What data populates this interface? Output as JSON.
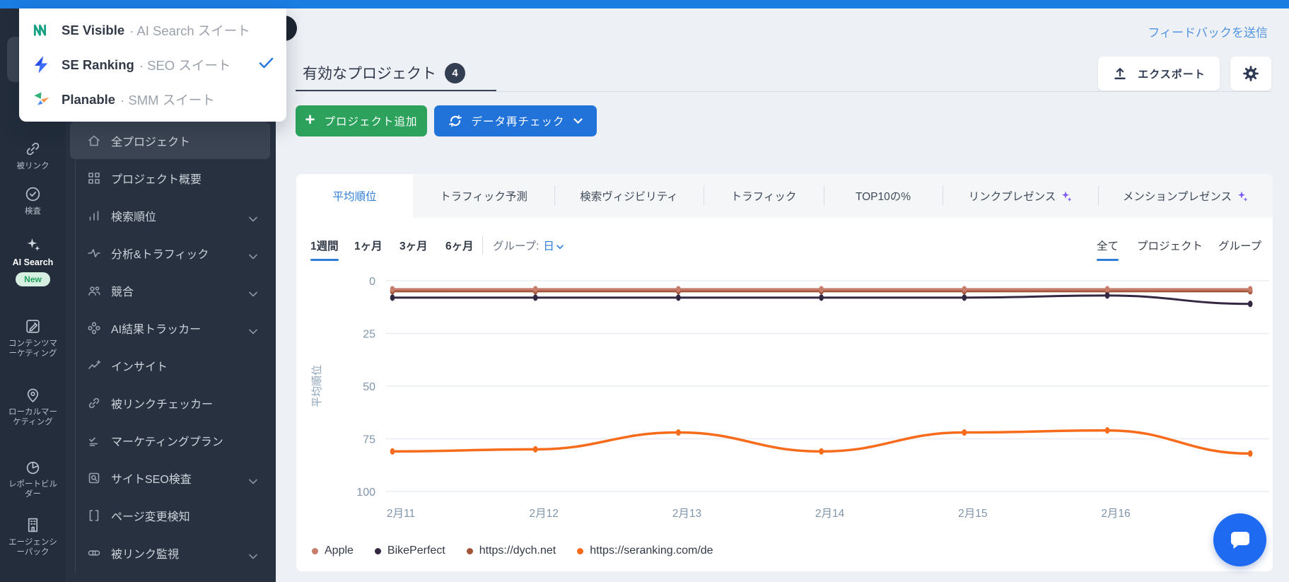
{
  "colors": {
    "topbar": "#1b7ce2",
    "sidebar": "#273140",
    "accent_blue": "#2e7cd6",
    "button_green": "#2ca25d",
    "button_blue": "#2173d9",
    "ai_sparkle": "#7a5af8",
    "chat_fab": "#1e6bf1"
  },
  "suite_switcher": {
    "items": [
      {
        "name": "SE Visible",
        "suffix": "· AI Search スイート"
      },
      {
        "name": "SE Ranking",
        "suffix": "· SEO スイート",
        "selected": true
      },
      {
        "name": "Planable",
        "suffix": "· SMM スイート"
      }
    ]
  },
  "rail": {
    "items": [
      {
        "label": "被リンク"
      },
      {
        "label": "検査"
      },
      {
        "label": "AI Search",
        "badge": "New"
      },
      {
        "label": "コンテンツマーケティング"
      },
      {
        "label": "ローカルマーケティング"
      },
      {
        "label": "レポートビルダー"
      },
      {
        "label": "エージェンシーパック"
      }
    ]
  },
  "sidebar": {
    "items": [
      {
        "label": "全プロジェクト",
        "active": true
      },
      {
        "label": "プロジェクト概要"
      },
      {
        "label": "検索順位",
        "expandable": true
      },
      {
        "label": "分析&トラフィック",
        "expandable": true
      },
      {
        "label": "競合",
        "expandable": true
      },
      {
        "label": "AI結果トラッカー",
        "expandable": true
      },
      {
        "label": "インサイト"
      },
      {
        "label": "被リンクチェッカー"
      },
      {
        "label": "マーケティングプラン"
      },
      {
        "label": "サイトSEO検査",
        "expandable": true
      },
      {
        "label": "ページ変更検知"
      },
      {
        "label": "被リンク監視",
        "expandable": true
      }
    ]
  },
  "header": {
    "feedback_link": "フィードバックを送信",
    "active_tab": "有効なプロジェクト",
    "badge_count": "4",
    "export_label": "エクスポート"
  },
  "toolbar": {
    "add_project_label": "プロジェクト追加",
    "recheck_label": "データ再チェック"
  },
  "chart_tabs": [
    {
      "label": "平均順位",
      "active": true
    },
    {
      "label": "トラフィック予測"
    },
    {
      "label": "検索ヴィジビリティ"
    },
    {
      "label": "トラフィック"
    },
    {
      "label": "TOP10の%"
    },
    {
      "label": "リンクプレゼンス",
      "ai": true
    },
    {
      "label": "メンションプレゼンス",
      "ai": true
    }
  ],
  "time_ranges": [
    {
      "label": "1週間",
      "active": true
    },
    {
      "label": "1ヶ月"
    },
    {
      "label": "3ヶ月"
    },
    {
      "label": "6ヶ月"
    }
  ],
  "group_by": {
    "label": "グループ:",
    "value": "日"
  },
  "scope_tabs": [
    {
      "label": "全て",
      "active": true
    },
    {
      "label": "プロジェクト"
    },
    {
      "label": "グループ"
    }
  ],
  "chart_data": {
    "type": "line",
    "title": "",
    "ylabel": "平均順位",
    "y_axis_inverted": true,
    "ylim": [
      0,
      100
    ],
    "yticks": [
      0,
      25,
      50,
      75,
      100
    ],
    "x_labels": [
      "2月11",
      "2月12",
      "2月13",
      "2月14",
      "2月15",
      "2月16",
      ""
    ],
    "grid": true,
    "legend_position": "bottom",
    "series": [
      {
        "name": "Apple",
        "color": "#c87d6b",
        "values": [
          4,
          4,
          4,
          4,
          4,
          4,
          4
        ]
      },
      {
        "name": "BikePerfect",
        "color": "#342742",
        "values": [
          8,
          8,
          8,
          8,
          8,
          7,
          11
        ]
      },
      {
        "name": "https://dych.net",
        "color": "#a3553a",
        "values": [
          5,
          5,
          5,
          5,
          5,
          5,
          5
        ]
      },
      {
        "name": "https://seranking.com/de",
        "color": "#f76b1c",
        "values": [
          81,
          80,
          72,
          81,
          72,
          71,
          82
        ]
      }
    ]
  }
}
